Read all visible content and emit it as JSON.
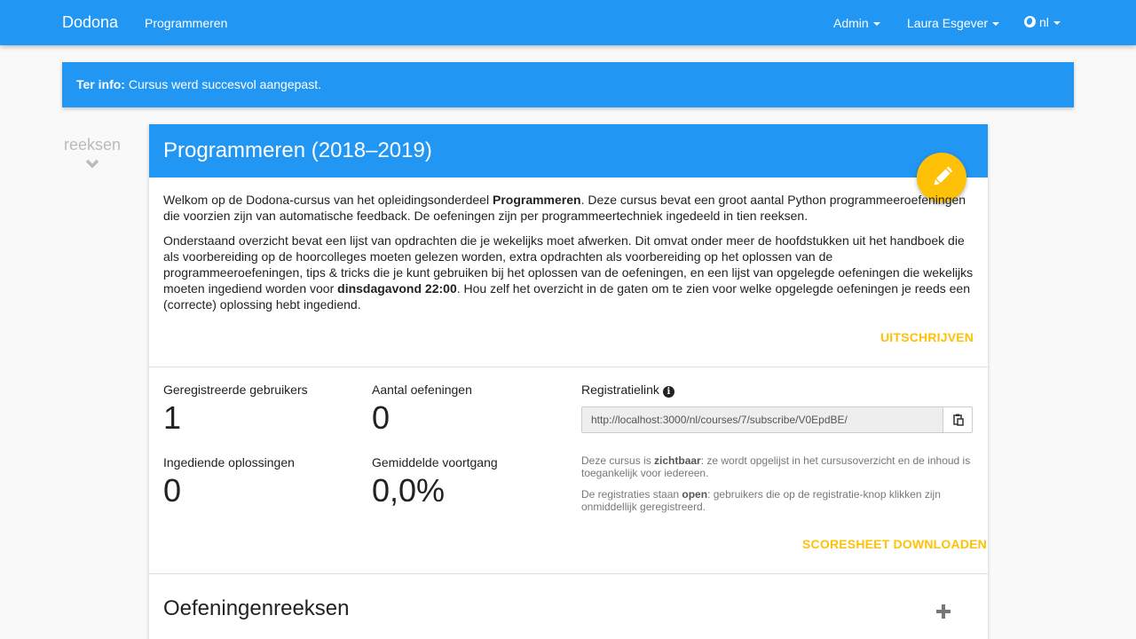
{
  "navbar": {
    "brand": "Dodona",
    "links": [
      "Programmeren"
    ],
    "admin": "Admin",
    "user": "Laura Esgever",
    "language": "nl"
  },
  "alert": {
    "prefix": "Ter info:",
    "message": "Cursus werd succesvol aangepast."
  },
  "rail": {
    "title": "reeksen",
    "chevron_icon": "chevron-down-icon"
  },
  "course": {
    "title": "Programmeren (2018–2019)",
    "edit_icon": "pencil-icon",
    "p1_a": "Welkom op de Dodona-cursus van het opleidingsonderdeel ",
    "p1_b": "Programmeren",
    "p1_c": ". Deze cursus bevat een groot aantal Python programmeeroefeningen die voorzien zijn van automatische feedback. De oefeningen zijn per programmeertechniek ingedeeld in tien reeksen.",
    "p2_a": "Onderstaand overzicht bevat een lijst van opdrachten die je wekelijks moet afwerken. Dit omvat onder meer de hoofdstukken uit het handboek die als voorbereiding op de hoorcolleges moeten gelezen worden, extra opdrachten als voorbereiding op het oplossen van de programmeeroefeningen, tips & tricks die je kunt gebruiken bij het oplossen van de oefeningen, en een lijst van opgelegde oefeningen die wekelijks moeten ingediend worden voor ",
    "p2_b": "dinsdagavond 22:00",
    "p2_c": ". Hou zelf het overzicht in de gaten om te zien voor welke opgelegde oefeningen je reeds een (correcte) oplossing hebt ingediend.",
    "unsubscribe": "UITSCHRIJVEN"
  },
  "stats": {
    "registered_label": "Geregistreerde gebruikers",
    "registered_value": "1",
    "exercises_label": "Aantal oefeningen",
    "exercises_value": "0",
    "submissions_label": "Ingediende oplossingen",
    "submissions_value": "0",
    "progress_label": "Gemiddelde voortgang",
    "progress_value": "0,0%"
  },
  "registration": {
    "label": "Registratielink",
    "link": "http://localhost:3000/nl/courses/7/subscribe/V0EpdBE/",
    "visibility_a": "Deze cursus is ",
    "visibility_b": "zichtbaar",
    "visibility_c": ": ze wordt opgelijst in het cursusoverzicht en de inhoud is toegankelijk voor iedereen.",
    "registration_a": "De registraties staan ",
    "registration_b": "open",
    "registration_c": ": gebruikers die op de registratie-knop klikken zijn onmiddellijk geregistreerd.",
    "download": "SCORESHEET DOWNLOADEN"
  },
  "series": {
    "title": "Oefeningenreeksen",
    "add_icon": "plus-icon"
  },
  "colors": {
    "primary": "#2196f3",
    "accent": "#ffc107",
    "background": "#f9f9f9"
  }
}
